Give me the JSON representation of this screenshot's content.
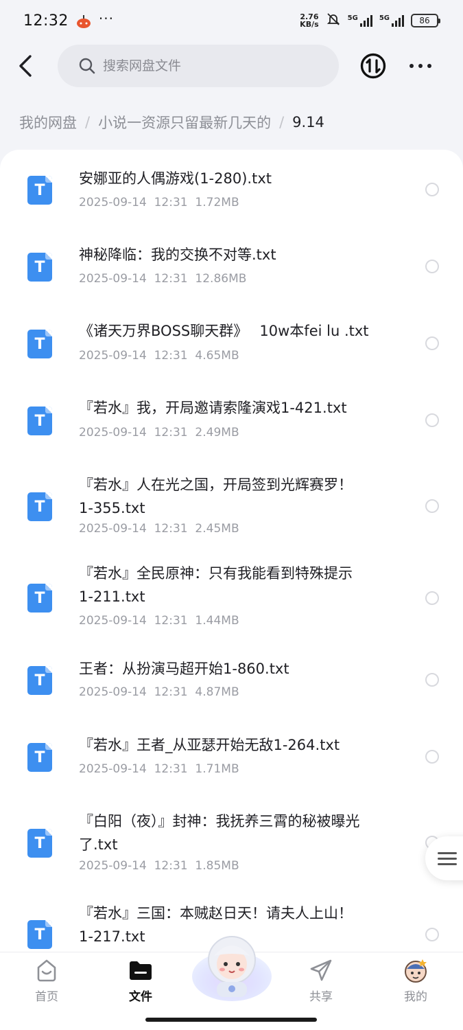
{
  "status_bar": {
    "time": "12:32",
    "more": "···",
    "net_speed_value": "2.76",
    "net_speed_unit": "KB/s",
    "signal1_label": "5G",
    "signal2_label": "5G",
    "battery": "86"
  },
  "header": {
    "search_placeholder": "搜索网盘文件"
  },
  "breadcrumb": {
    "root": "我的网盘",
    "folder": "小说一资源只留最新几天的",
    "current": "9.14",
    "separator": "/"
  },
  "file_icon_letter": "T",
  "files": [
    {
      "name": "安娜亚的人偶游戏(1-280).txt",
      "date": "2025-09-14",
      "time": "12:31",
      "size": "1.72MB"
    },
    {
      "name": "神秘降临：我的交换不对等.txt",
      "date": "2025-09-14",
      "time": "12:31",
      "size": "12.86MB"
    },
    {
      "name": "《诸天万界BOSS聊天群》　 10w本fei lu .txt",
      "date": "2025-09-14",
      "time": "12:31",
      "size": "4.65MB"
    },
    {
      "name": "『若水』我，开局邀请索隆演戏1-421.txt",
      "date": "2025-09-14",
      "time": "12:31",
      "size": "2.49MB"
    },
    {
      "name": "『若水』人在光之国，开局签到光辉赛罗！\n1-355.txt",
      "date": "2025-09-14",
      "time": "12:31",
      "size": "2.45MB"
    },
    {
      "name": "『若水』全民原神：只有我能看到特殊提示\n1-211.txt",
      "date": "2025-09-14",
      "time": "12:31",
      "size": "1.44MB"
    },
    {
      "name": "王者：从扮演马超开始1-860.txt",
      "date": "2025-09-14",
      "time": "12:31",
      "size": "4.87MB"
    },
    {
      "name": "『若水』王者_从亚瑟开始无敌1-264.txt",
      "date": "2025-09-14",
      "time": "12:31",
      "size": "1.71MB"
    },
    {
      "name": "『白阳（夜）』封神：我抚养三霄的秘被曝光\n了.txt",
      "date": "2025-09-14",
      "time": "12:31",
      "size": "1.85MB"
    },
    {
      "name": "『若水』三国：本贼赵日天！请夫人上山！\n1-217.txt",
      "date": "",
      "time": "",
      "size": ""
    }
  ],
  "bottom_nav": {
    "home": "首页",
    "files": "文件",
    "share": "共享",
    "mine": "我的"
  },
  "colors": {
    "accent": "#3d8ff0",
    "background": "#f3f4f8"
  },
  "icons": [
    "back-arrow-icon",
    "search-icon",
    "transfer-icon",
    "more-icon",
    "txt-file-icon",
    "menu-icon",
    "home-icon",
    "folder-icon",
    "share-icon",
    "avatar-icon",
    "mascot-icon"
  ]
}
